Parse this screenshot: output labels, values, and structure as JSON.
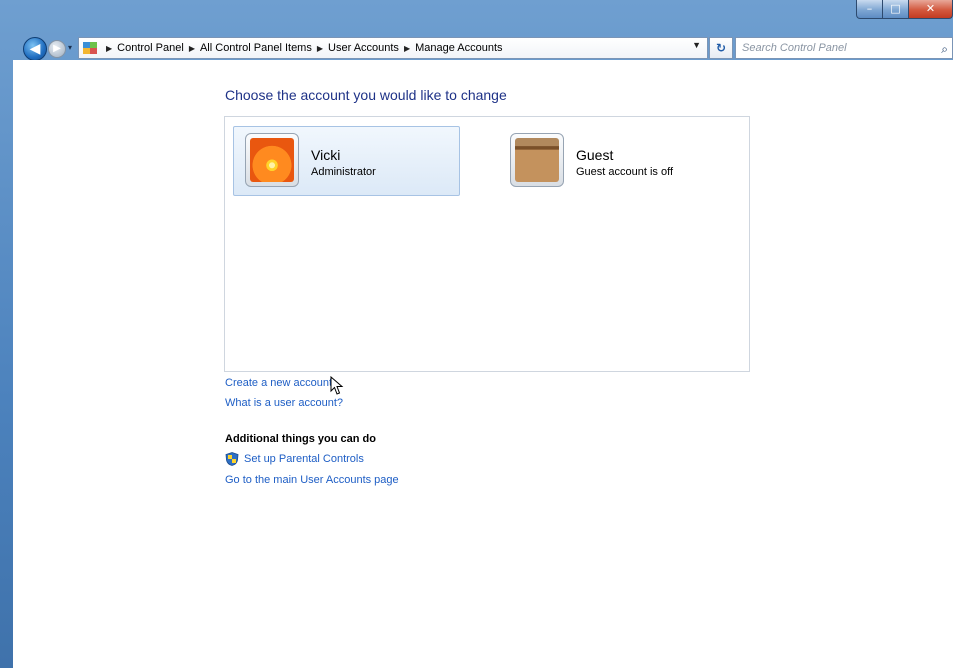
{
  "window": {
    "controls": {
      "minimize": "–",
      "maximize": "□",
      "close": "✕"
    }
  },
  "navigation": {
    "back_icon": "◀",
    "forward_icon": "▶",
    "recent_icon": "▾",
    "breadcrumbs": [
      "Control Panel",
      "All Control Panel Items",
      "User Accounts",
      "Manage Accounts"
    ],
    "refresh_icon": "↻",
    "search_placeholder": "Search Control Panel",
    "search_icon": "⌕"
  },
  "main": {
    "heading": "Choose the account you would like to change",
    "accounts": [
      {
        "name": "Vicki",
        "role": "Administrator",
        "picture": "orange-flower",
        "selected": true
      },
      {
        "name": "Guest",
        "role": "Guest account is off",
        "picture": "briefcase",
        "selected": false
      }
    ],
    "links": {
      "create": "Create a new account",
      "what_is": "What is a user account?"
    },
    "additional": {
      "heading": "Additional things you can do",
      "parental": "Set up Parental Controls",
      "main_page": "Go to the main User Accounts page"
    }
  },
  "colors": {
    "link": "#1e5ec5",
    "heading": "#1e3287",
    "chrome": "#4c82bd"
  }
}
